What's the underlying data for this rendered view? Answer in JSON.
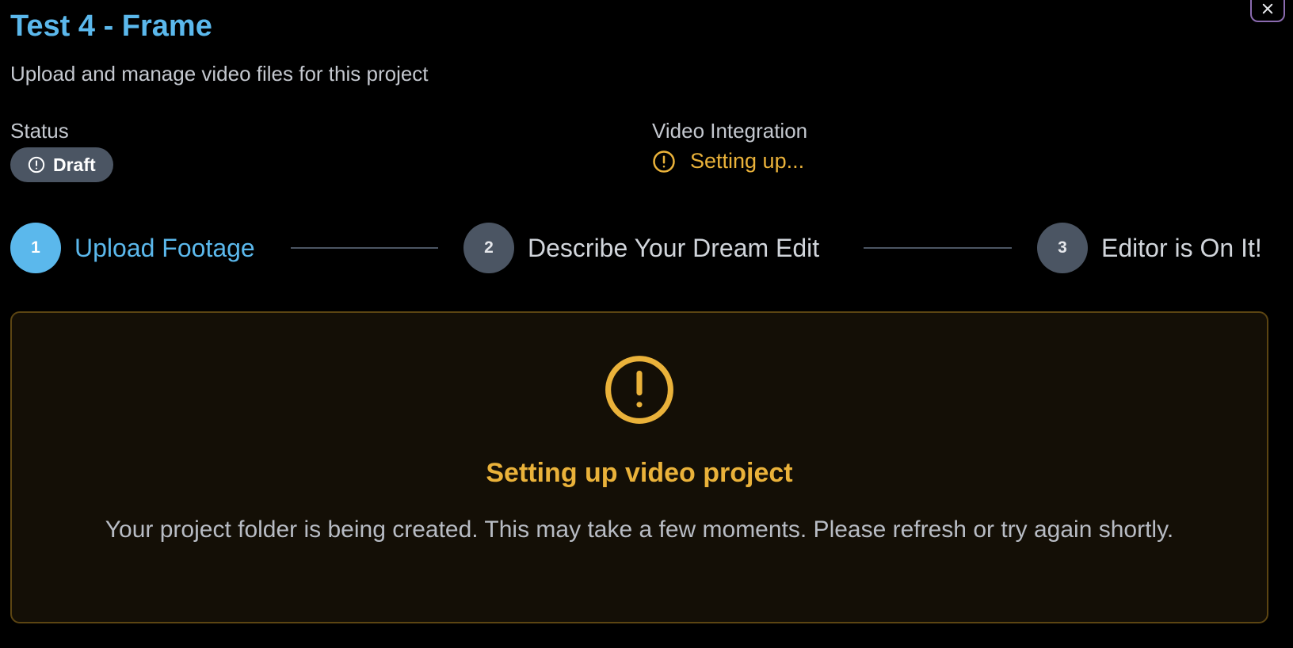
{
  "header": {
    "title": "Test 4 - Frame",
    "subtitle": "Upload and manage video files for this project"
  },
  "status": {
    "label": "Status",
    "badge": "Draft",
    "badge_icon": "alert-circle-icon"
  },
  "integration": {
    "label": "Video Integration",
    "value": "Setting up...",
    "icon": "alert-circle-icon"
  },
  "steps": [
    {
      "number": "1",
      "label": "Upload Footage",
      "active": true
    },
    {
      "number": "2",
      "label": "Describe Your Dream Edit",
      "active": false
    },
    {
      "number": "3",
      "label": "Editor is On It!",
      "active": false
    }
  ],
  "notice": {
    "icon": "alert-circle-icon",
    "title": "Setting up video project",
    "message": "Your project folder is being created. This may take a few moments. Please refresh or try again shortly."
  },
  "close_icon": "close-icon",
  "colors": {
    "accent": "#5bb8ec",
    "warning": "#eab23a",
    "badge_bg": "#4b5563",
    "panel_bg": "#140f06",
    "panel_border": "#5c4512",
    "background": "#000000"
  }
}
